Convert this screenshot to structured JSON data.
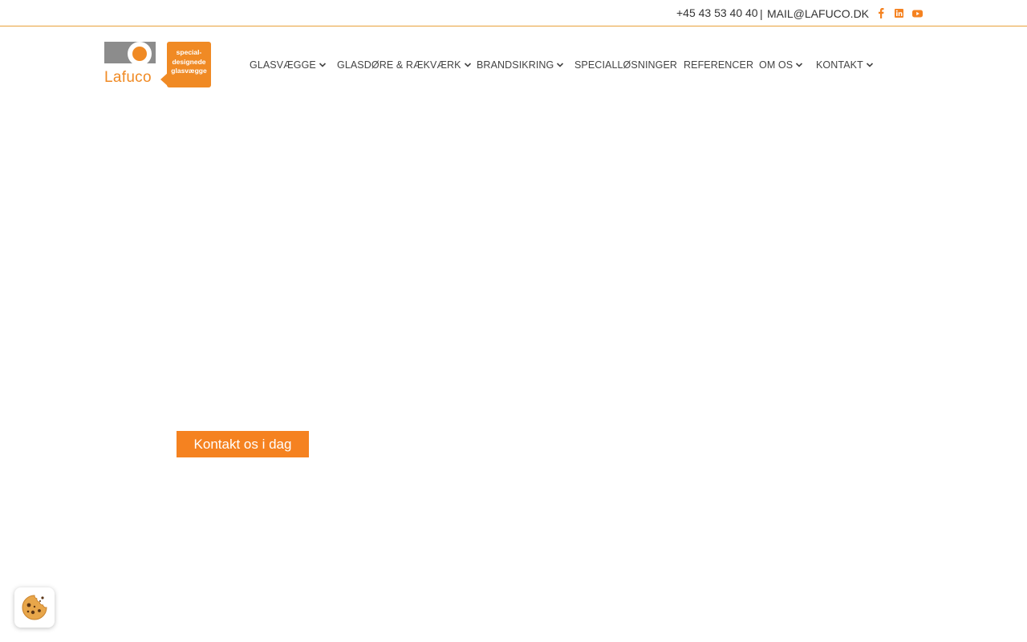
{
  "topbar": {
    "phone": "+45 43 53 40 40",
    "separator": "|",
    "email": "MAIL@LAFUCO.DK",
    "social": [
      "facebook-icon",
      "linkedin-icon",
      "youtube-icon"
    ]
  },
  "logo": {
    "brand": "Lafuco",
    "tagline_1": "special-",
    "tagline_2": "designede",
    "tagline_3": "glasvægge"
  },
  "nav": {
    "items": [
      {
        "label": "GLASVÆGGE",
        "dropdown": true
      },
      {
        "label": "GLASDØRE & RÆKVÆRK",
        "dropdown": true
      },
      {
        "label": "BRANDSIKRING",
        "dropdown": true
      },
      {
        "label": "SPECIALLØSNINGER",
        "dropdown": false
      },
      {
        "label": "REFERENCER",
        "dropdown": false
      },
      {
        "label": "OM OS",
        "dropdown": true
      },
      {
        "label": "KONTAKT",
        "dropdown": true
      }
    ]
  },
  "hero": {
    "cta_label": "Kontakt os i dag"
  },
  "colors": {
    "accent": "#f58220",
    "logo_grey": "#8c8c8c",
    "divider": "#e8a13a"
  },
  "cookie_widget": {
    "icon": "cookie-icon"
  }
}
